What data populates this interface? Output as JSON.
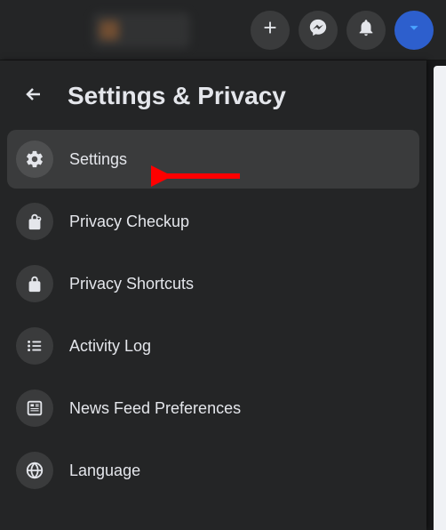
{
  "header": {
    "title": "Settings & Privacy"
  },
  "topbar": {
    "icons": [
      "plus",
      "messenger",
      "bell",
      "caret"
    ]
  },
  "menu": {
    "items": [
      {
        "id": "settings",
        "label": "Settings",
        "icon": "gear",
        "hovered": true
      },
      {
        "id": "privacy-checkup",
        "label": "Privacy Checkup",
        "icon": "lock-heart",
        "hovered": false
      },
      {
        "id": "privacy-shortcuts",
        "label": "Privacy Shortcuts",
        "icon": "lock",
        "hovered": false
      },
      {
        "id": "activity-log",
        "label": "Activity Log",
        "icon": "list",
        "hovered": false
      },
      {
        "id": "news-feed-preferences",
        "label": "News Feed Preferences",
        "icon": "feed",
        "hovered": false
      },
      {
        "id": "language",
        "label": "Language",
        "icon": "globe",
        "hovered": false
      }
    ]
  },
  "annotation": {
    "arrow_target": "settings"
  }
}
